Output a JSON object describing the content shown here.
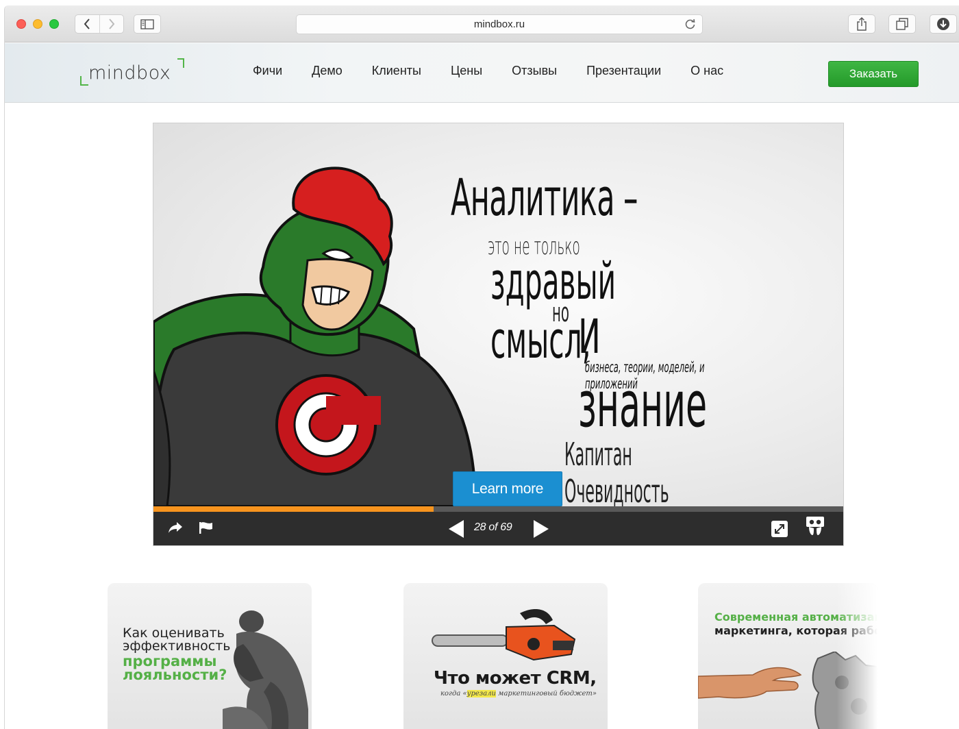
{
  "browser": {
    "url": "mindbox.ru"
  },
  "header": {
    "logo_text": "mindbox",
    "nav": [
      "Фичи",
      "Демо",
      "Клиенты",
      "Цены",
      "Отзывы",
      "Презентации",
      "О нас"
    ],
    "cta_label": "Заказать"
  },
  "slideshow": {
    "quote_line1": "Аналитика –",
    "quote_line2": "это не только",
    "quote_line3": "здравый смысл,",
    "quote_line4": "но",
    "quote_line5": "и знание",
    "quote_line6": "бизнеса, теории, моделей, и приложений",
    "quote_author": "Капитан Очевидность",
    "learn_more_label": "Learn more",
    "current_slide": 28,
    "total_slides": 69,
    "counter_label": "28 of 69",
    "progress": 0.406
  },
  "cards": [
    {
      "line1": "Как оценивать эффективность",
      "line2": "программы лояльности?"
    },
    {
      "title": "Что может CRM,",
      "subtitle_before": "когда «",
      "subtitle_highlight": "урезали",
      "subtitle_after": " маркетинговый бюджет»"
    },
    {
      "line1": "Современная автоматизац",
      "line2": "маркетинга, которая работ"
    }
  ],
  "colors": {
    "brand_green": "#52b548",
    "cta_green": "#2ea834",
    "learn_more_blue": "#1b8fd1",
    "progress_orange": "#f7941e",
    "controls_bg": "#2d2d2d"
  }
}
